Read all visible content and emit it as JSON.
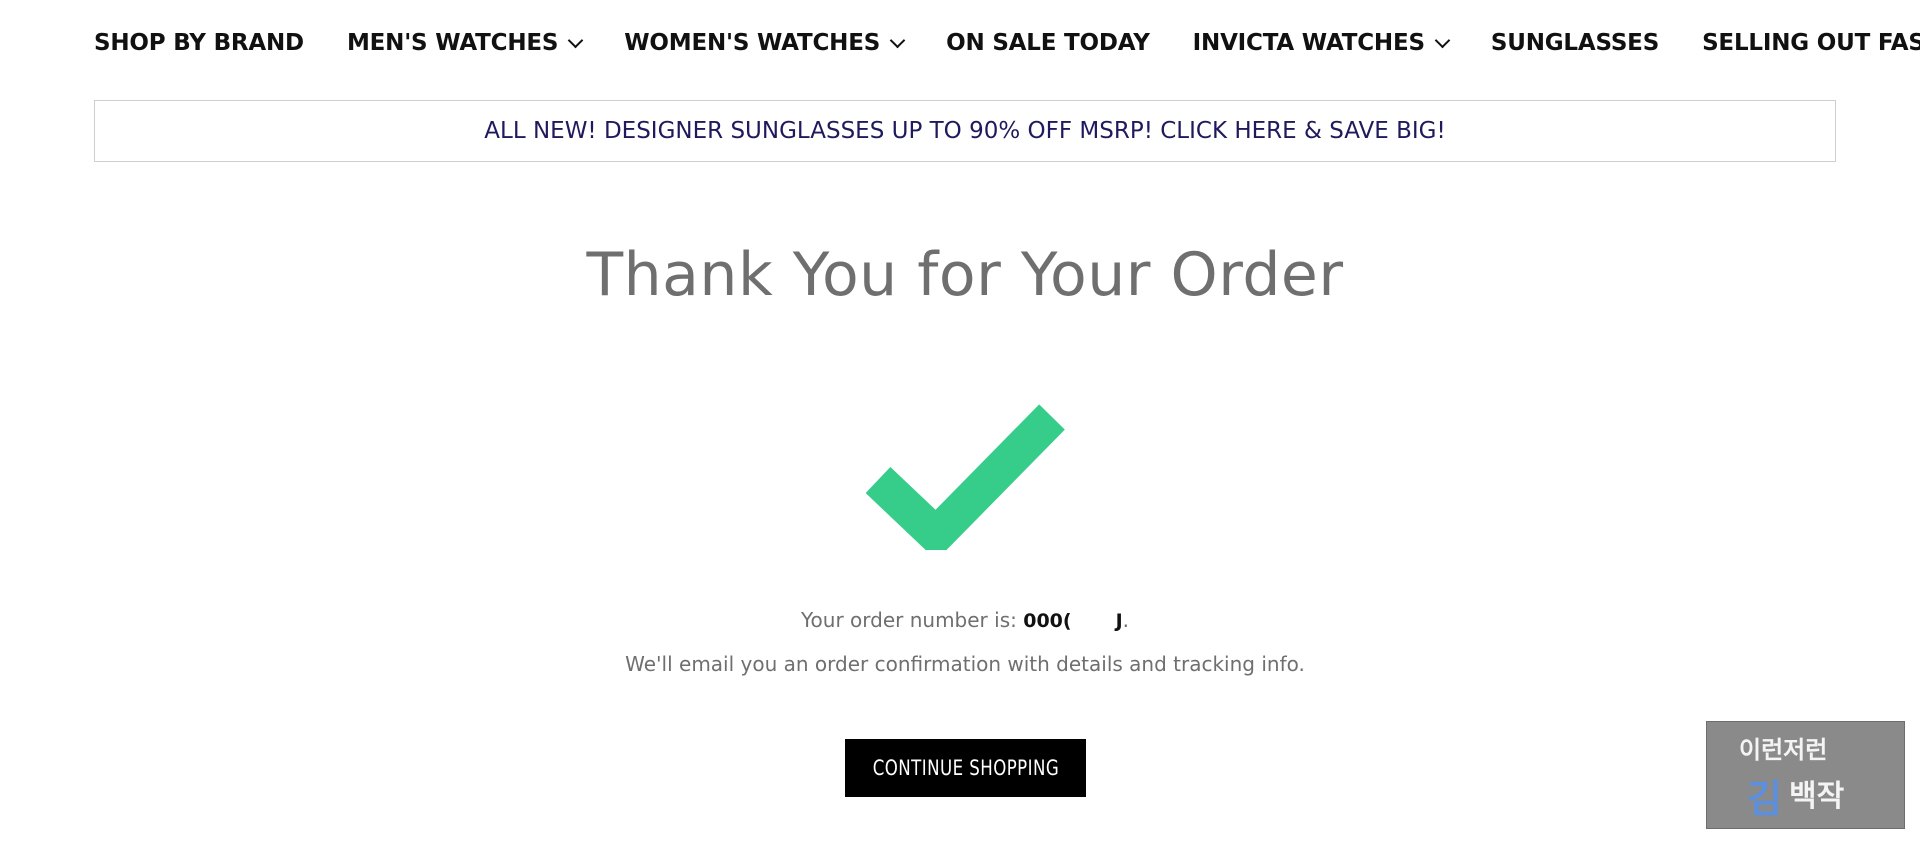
{
  "nav": {
    "items": [
      {
        "label": "SHOP BY BRAND",
        "has_dropdown": false
      },
      {
        "label": "MEN'S WATCHES",
        "has_dropdown": true
      },
      {
        "label": "WOMEN'S WATCHES",
        "has_dropdown": true
      },
      {
        "label": "ON SALE TODAY",
        "has_dropdown": false
      },
      {
        "label": "INVICTA WATCHES",
        "has_dropdown": true
      },
      {
        "label": "SUNGLASSES",
        "has_dropdown": false
      },
      {
        "label": "SELLING OUT FAST!",
        "has_dropdown": false
      }
    ]
  },
  "promo": {
    "text": "ALL NEW! DESIGNER SUNGLASSES UP TO 90% OFF MSRP! CLICK HERE & SAVE BIG!",
    "color": "#1f1a5c"
  },
  "confirmation": {
    "title": "Thank You for Your Order",
    "check_icon": "checkmark-icon",
    "check_color": "#36cd8a",
    "order_prefix": "Your order number is: ",
    "order_number_start": "000(",
    "order_number_end": "J",
    "order_suffix": ".",
    "email_note": "We'll email you an order confirmation with details and tracking info."
  },
  "actions": {
    "continue_label": "CONTINUE SHOPPING"
  },
  "watermark": {
    "text_top": "이런저런",
    "text_bottom": "김백작",
    "background": "#8a8a8a"
  }
}
